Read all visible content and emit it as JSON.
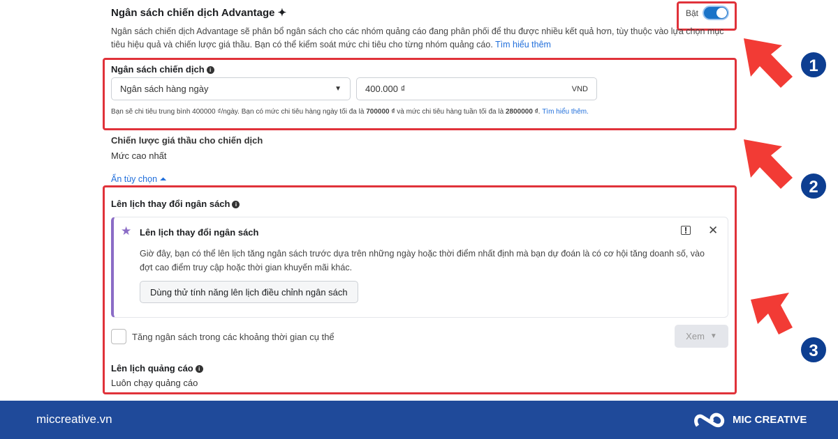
{
  "advantage": {
    "title": "Ngân sách chiến dịch Advantage ✦",
    "toggle_label": "Bật",
    "toggle_on": true,
    "description": "Ngân sách chiến dịch Advantage sẽ phân bổ ngân sách cho các nhóm quảng cáo đang phân phối để thu được nhiều kết quả hơn, tùy thuộc vào lựa chọn mục tiêu hiệu quả và chiến lược giá thầu. Bạn có thể kiểm soát mức chi tiêu cho từng nhóm quảng cáo. ",
    "learn_more": "Tìm hiểu thêm"
  },
  "budget": {
    "label": "Ngân sách chiến dịch",
    "type_value": "Ngân sách hàng ngày",
    "amount_value": "400.000 ₫",
    "currency": "VND",
    "note_1": "Bạn sẽ chi tiêu trung bình 400000 ₫/ngày. Bạn có mức chi tiêu hàng ngày tối đa là ",
    "max_daily": "700000 ₫",
    "note_2": " và mức chi tiêu hàng tuần tối đa là ",
    "max_weekly": "2800000 ₫",
    "note_3": ". ",
    "learn_more": "Tìm hiểu thêm."
  },
  "bid": {
    "label": "Chiến lược giá thầu cho chiến dịch",
    "value": "Mức cao nhất"
  },
  "hide_options": "Ẩn tùy chọn ⏶",
  "schedule": {
    "label": "Lên lịch thay đổi ngân sách",
    "card": {
      "title": "Lên lịch thay đổi ngân sách",
      "body": "Giờ đây, bạn có thể lên lịch tăng ngân sách trước dựa trên những ngày hoặc thời điểm nhất định mà bạn dự đoán là có cơ hội tăng doanh số, vào đợt cao điểm truy cập hoặc thời gian khuyến mãi khác.",
      "button": "Dùng thử tính năng lên lịch điều chỉnh ngân sách"
    },
    "checkbox_label": "Tăng ngân sách trong các khoảng thời gian cụ thể",
    "view_button": "Xem"
  },
  "ad_schedule": {
    "label": "Lên lịch quảng cáo",
    "value": "Luôn chạy quảng cáo"
  },
  "annotations": [
    "1",
    "2",
    "3"
  ],
  "footer": {
    "site": "miccreative.vn",
    "brand": "MIC CREATIVE"
  },
  "colors": {
    "highlight": "#e0323a",
    "footer": "#1f4a9a",
    "toggle": "#1a73c8"
  }
}
